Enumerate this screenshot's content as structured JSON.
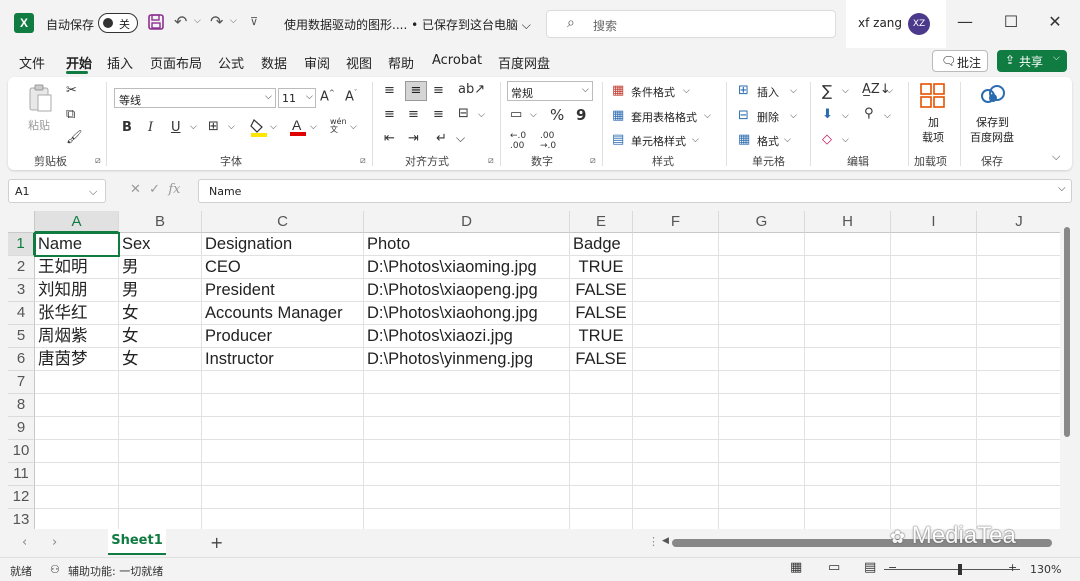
{
  "titlebar": {
    "app_logo": "X",
    "autosave_label": "自动保存",
    "autosave_state": "关",
    "doc_title": "使用数据驱动的图形.... • 已保存到这台电脑 ⌵",
    "search_placeholder": "搜索",
    "user_name": "xf zang",
    "user_initials": "XZ"
  },
  "menu": {
    "tabs": [
      "文件",
      "开始",
      "插入",
      "页面布局",
      "公式",
      "数据",
      "审阅",
      "视图",
      "帮助",
      "Acrobat",
      "百度网盘"
    ],
    "active_tab": "开始",
    "notes_label": "批注",
    "share_label": "共享"
  },
  "ribbon": {
    "clipboard": {
      "paste": "粘贴",
      "group": "剪贴板"
    },
    "font": {
      "name": "等线",
      "size": "11",
      "bold": "B",
      "italic": "I",
      "underline": "U",
      "group": "字体"
    },
    "alignment": {
      "group": "对齐方式"
    },
    "number": {
      "format": "常规",
      "percent": "%",
      "comma": "9",
      "group": "数字"
    },
    "styles": {
      "conditional": "条件格式",
      "table": "套用表格格式",
      "cell_styles": "单元格样式",
      "group": "样式"
    },
    "cells": {
      "insert": "插入",
      "delete": "删除",
      "format": "格式",
      "group": "单元格"
    },
    "editing": {
      "group": "编辑"
    },
    "addins": {
      "label": "加\n载项",
      "label1": "加",
      "label2": "载项",
      "group": "加载项"
    },
    "save": {
      "label1": "保存到",
      "label2": "百度网盘",
      "group": "保存"
    }
  },
  "formula_bar": {
    "name_box": "A1",
    "fx": "fx",
    "content": "Name"
  },
  "grid": {
    "columns": [
      "A",
      "B",
      "C",
      "D",
      "E",
      "F",
      "G",
      "H",
      "I",
      "J"
    ],
    "rows": [
      "1",
      "2",
      "3",
      "4",
      "5",
      "6",
      "7",
      "8",
      "9",
      "10",
      "11",
      "12",
      "13"
    ],
    "data": [
      [
        "Name",
        "Sex",
        "Designation",
        "Photo",
        "Badge"
      ],
      [
        "王如明",
        "男",
        "CEO",
        "D:\\Photos\\xiaoming.jpg",
        "TRUE"
      ],
      [
        "刘知朋",
        "男",
        "President",
        "D:\\Photos\\xiaopeng.jpg",
        "FALSE"
      ],
      [
        "张华红",
        "女",
        "Accounts Manager",
        "D:\\Photos\\xiaohong.jpg",
        "FALSE"
      ],
      [
        "周烟紫",
        "女",
        "Producer",
        "D:\\Photos\\xiaozi.jpg",
        "TRUE"
      ],
      [
        "唐茵梦",
        "女",
        "Instructor",
        "D:\\Photos\\yinmeng.jpg",
        "FALSE"
      ]
    ],
    "active_cell": "A1"
  },
  "sheets": {
    "tabs": [
      "Sheet1"
    ],
    "add_label": "+"
  },
  "watermark": "MediaTea",
  "status": {
    "ready": "就绪",
    "accessibility": "辅助功能: 一切就绪",
    "zoom": "130%"
  },
  "colors": {
    "accent": "#107c41",
    "avatar": "#4b3a8c"
  }
}
